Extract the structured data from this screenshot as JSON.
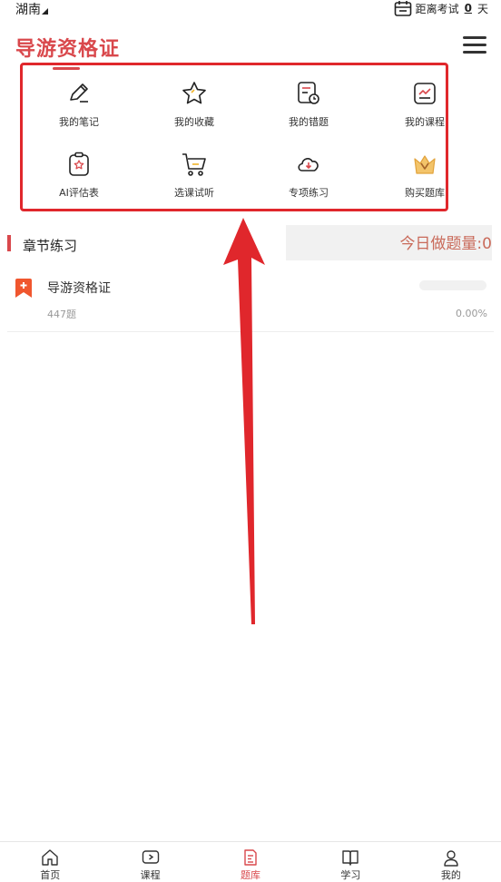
{
  "status": {
    "region": "湖南",
    "countdown_prefix": "距离考试",
    "countdown_days": "0",
    "countdown_suffix": "天"
  },
  "header": {
    "title": "导游资格证"
  },
  "quick_links": [
    {
      "label": "我的笔记",
      "icon": "pencil-note-icon"
    },
    {
      "label": "我的收藏",
      "icon": "star-icon"
    },
    {
      "label": "我的错题",
      "icon": "wrong-questions-icon"
    },
    {
      "label": "我的课程",
      "icon": "course-chart-icon"
    },
    {
      "label": "AI评估表",
      "icon": "clipboard-star-icon"
    },
    {
      "label": "选课试听",
      "icon": "cart-icon"
    },
    {
      "label": "专项练习",
      "icon": "cloud-download-icon"
    },
    {
      "label": "购买题库",
      "icon": "crown-icon"
    }
  ],
  "section": {
    "title": "章节练习",
    "today_label": "今日做题量:",
    "today_count": "0"
  },
  "course": {
    "name": "导游资格证",
    "count": "447题",
    "progress_text": "0.00%",
    "progress_value": 0
  },
  "tabs": [
    {
      "label": "首页",
      "icon": "home-icon",
      "active": false
    },
    {
      "label": "课程",
      "icon": "play-course-icon",
      "active": false
    },
    {
      "label": "题库",
      "icon": "question-bank-icon",
      "active": true
    },
    {
      "label": "学习",
      "icon": "book-icon",
      "active": false
    },
    {
      "label": "我的",
      "icon": "profile-icon",
      "active": false
    }
  ],
  "colors": {
    "accent": "#d9484c",
    "annotation_red": "#e0272c",
    "today_text": "#c96a5a"
  }
}
